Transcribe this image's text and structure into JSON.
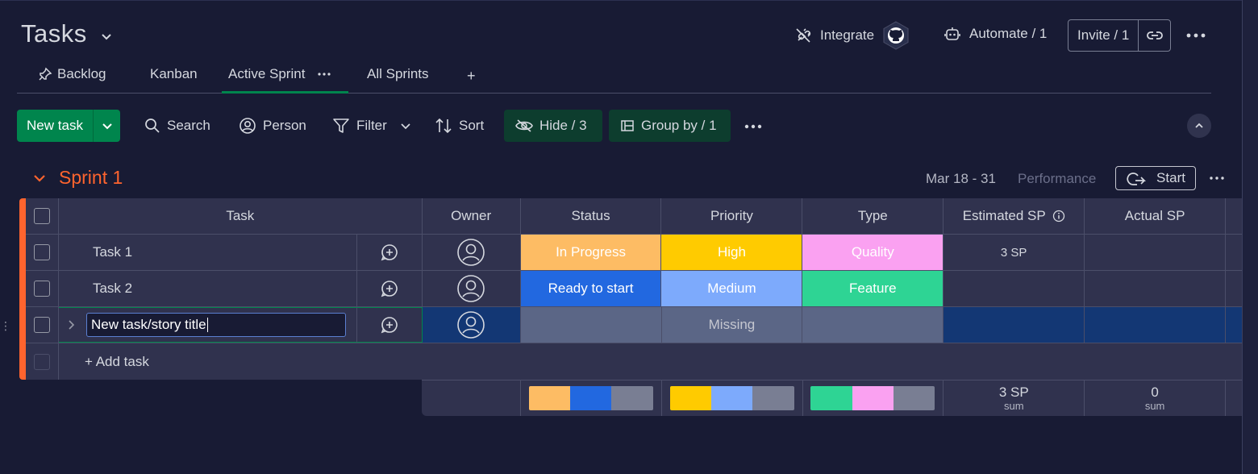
{
  "header": {
    "title": "Tasks",
    "integrate_label": "Integrate",
    "automate_label": "Automate / 1",
    "invite_label": "Invite / 1"
  },
  "tabs": [
    {
      "label": "Backlog",
      "icon": "pin-icon"
    },
    {
      "label": "Kanban"
    },
    {
      "label": "Active Sprint",
      "active": true
    },
    {
      "label": "All Sprints"
    },
    {
      "label": "+"
    }
  ],
  "toolbar": {
    "new_task": "New task",
    "search": "Search",
    "person": "Person",
    "filter": "Filter",
    "sort": "Sort",
    "hide": "Hide / 3",
    "group_by": "Group by / 1"
  },
  "group": {
    "title": "Sprint 1",
    "dates": "Mar 18 - 31",
    "performance": "Performance",
    "start_label": "Start",
    "color": "#ff642e"
  },
  "columns": {
    "task": "Task",
    "owner": "Owner",
    "status": "Status",
    "priority": "Priority",
    "type": "Type",
    "estimated": "Estimated SP",
    "actual": "Actual SP"
  },
  "rows": [
    {
      "task": "Task 1",
      "status": "In Progress",
      "status_color": "#fdbc64",
      "priority": "High",
      "priority_color": "#ffcb00",
      "type": "Quality",
      "type_color": "#faa1f1",
      "estimated": "3 SP",
      "actual": ""
    },
    {
      "task": "Task 2",
      "status": "Ready to start",
      "status_color": "#2268e0",
      "priority": "Medium",
      "priority_color": "#7daafc",
      "type": "Feature",
      "type_color": "#2ed494",
      "estimated": "",
      "actual": ""
    }
  ],
  "new_row": {
    "task_value": "New task/story title",
    "priority": "Missing"
  },
  "add_task": "+ Add task",
  "summary": {
    "estimated_value": "3 SP",
    "estimated_caption": "sum",
    "actual_value": "0",
    "actual_caption": "sum",
    "status_colors": [
      "#fdbc64",
      "#2268e0",
      "#797e93"
    ],
    "priority_colors": [
      "#ffcb00",
      "#7daafc",
      "#797e93"
    ],
    "type_colors": [
      "#2ed494",
      "#faa1f1",
      "#797e93"
    ]
  }
}
